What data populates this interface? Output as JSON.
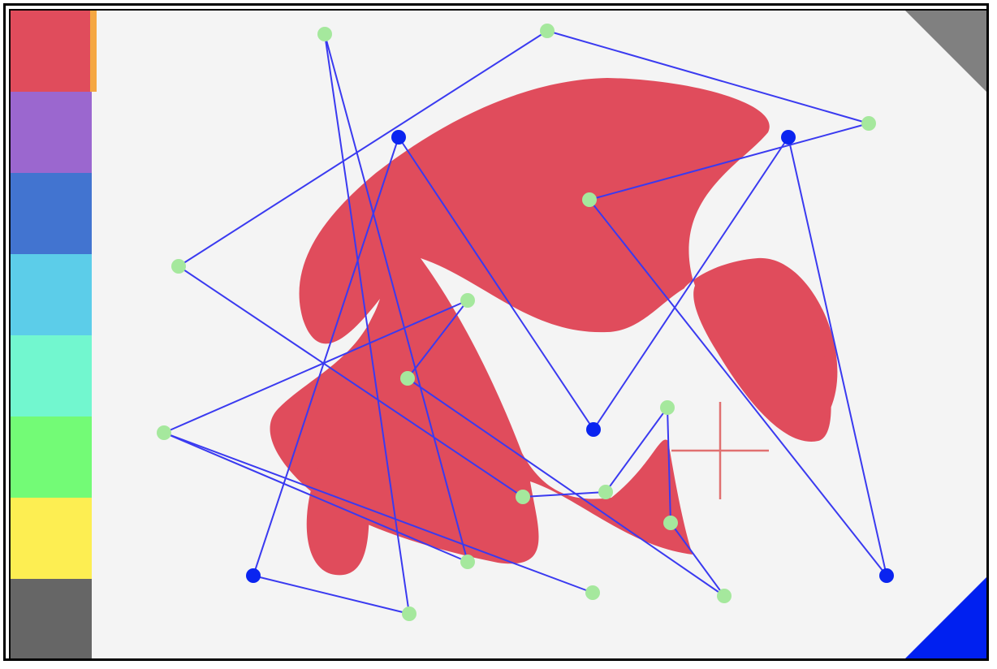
{
  "palette": {
    "selected_index": 0,
    "selected_marker_color": "#f5a742",
    "swatches": [
      {
        "name": "red",
        "color": "#e04c5c"
      },
      {
        "name": "purple",
        "color": "#9b67cf"
      },
      {
        "name": "blue",
        "color": "#4274d0"
      },
      {
        "name": "cyan",
        "color": "#5ccde9"
      },
      {
        "name": "aquamarine",
        "color": "#72f7cf"
      },
      {
        "name": "green",
        "color": "#73fb76"
      },
      {
        "name": "yellow",
        "color": "#fdee52"
      },
      {
        "name": "gray",
        "color": "#666666"
      }
    ]
  },
  "canvas": {
    "background": "#f4f4f4",
    "fill_color": "#e04c5c",
    "line_color": "#3a3af0",
    "anchor_point_color": "#0a24f0",
    "control_point_color": "#a5e89d",
    "cursor": {
      "icon": "crosshair-cursor",
      "color": "#e07070"
    }
  },
  "corners": {
    "top_right": {
      "icon": "fold-corner-icon",
      "color": "#808080"
    },
    "bottom_right": {
      "icon": "fold-corner-icon",
      "color": "#0020f0"
    }
  }
}
